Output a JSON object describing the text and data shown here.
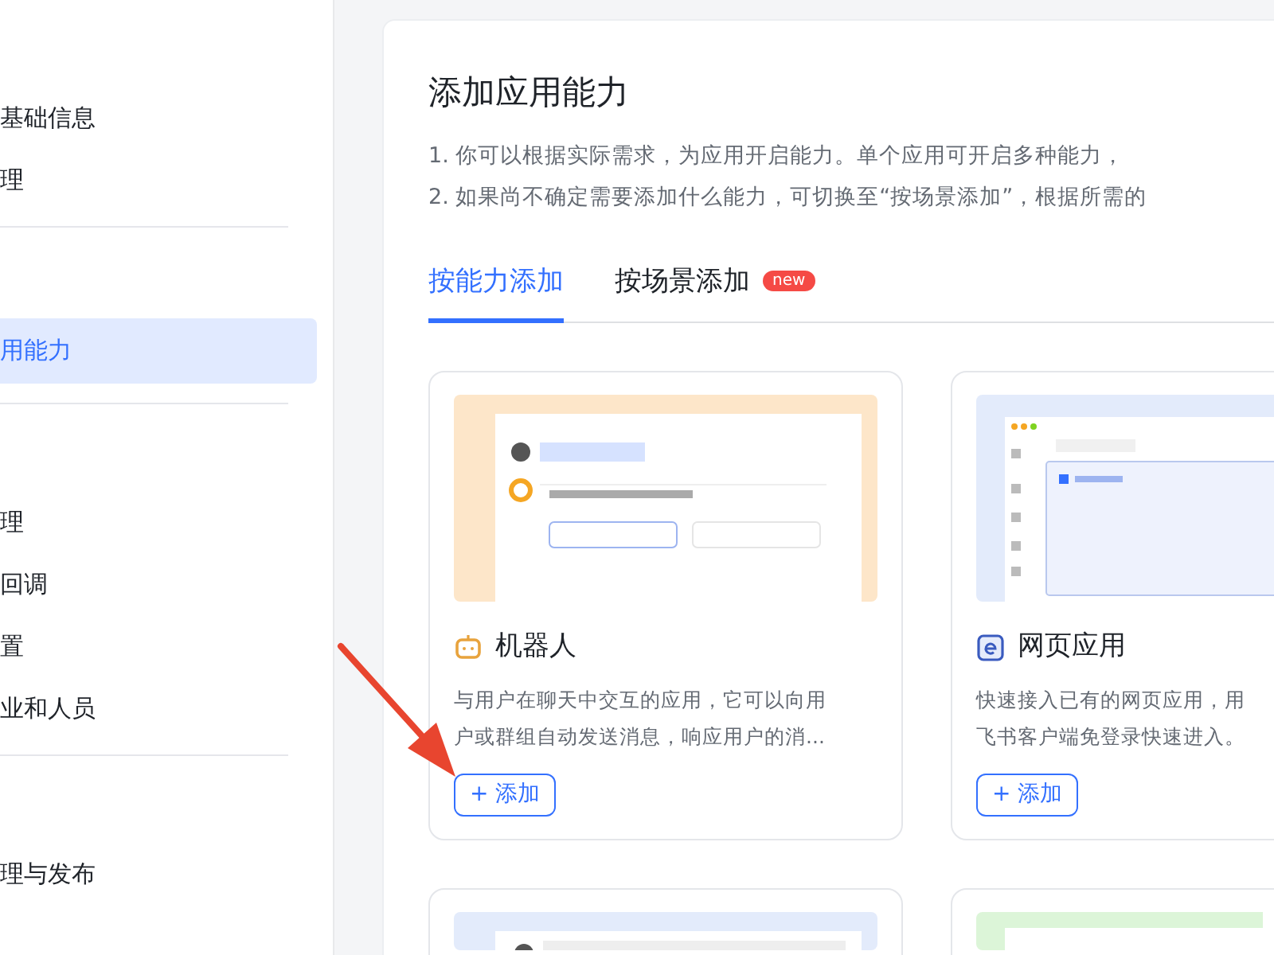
{
  "sidebar": {
    "sections": [
      {
        "items": [
          {
            "label": "基础信息",
            "selected": false
          },
          {
            "label": "理",
            "selected": false
          }
        ]
      },
      {
        "items": [
          {
            "label": "用能力",
            "selected": true
          }
        ]
      },
      {
        "items": [
          {
            "label": "理",
            "selected": false
          },
          {
            "label": "回调",
            "selected": false
          },
          {
            "label": "置",
            "selected": false
          },
          {
            "label": "业和人员",
            "selected": false
          }
        ]
      },
      {
        "items": [
          {
            "label": "理与发布",
            "selected": false
          }
        ]
      }
    ]
  },
  "panel": {
    "title": "添加应用能力",
    "notes": [
      "1. 你可以根据实际需求，为应用开启能力。单个应用可开启多种能力，",
      "2. 如果尚不确定需要添加什么能力，可切换至“按场景添加”，根据所需的"
    ],
    "tabs": [
      {
        "label": "按能力添加",
        "selected": true
      },
      {
        "label": "按场景添加",
        "selected": false,
        "badge": "new"
      }
    ],
    "cards": [
      {
        "kind": "robot",
        "title": "机器人",
        "description_lines": [
          "与用户在聊天中交互的应用，它可以向用",
          "户或群组自动发送消息，响应用户的消..."
        ],
        "button": "+ 添加"
      },
      {
        "kind": "web",
        "title": "网页应用",
        "description_lines": [
          "快速接入已有的网页应用，用",
          "飞书客户端免登录快速进入。"
        ],
        "button": "+ 添加"
      },
      {
        "kind": "chat"
      },
      {
        "kind": "green"
      }
    ]
  },
  "annotation": {
    "kind": "arrow"
  }
}
